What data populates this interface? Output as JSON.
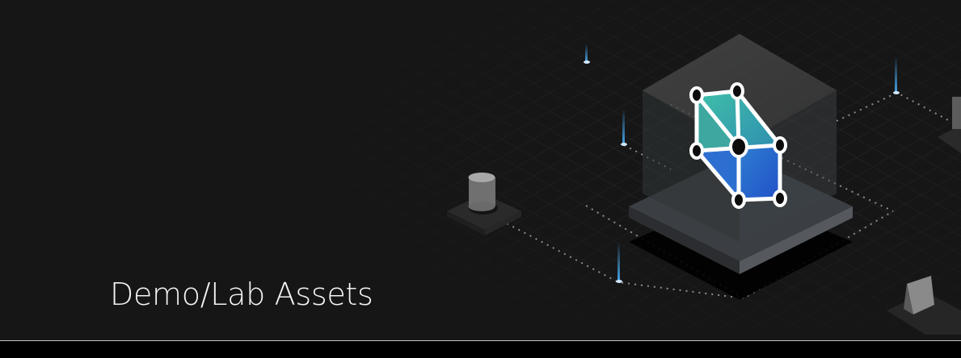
{
  "hero": {
    "title": "Demo/Lab Assets",
    "illustration": "isometric-platform-with-3d-network-icon",
    "colors": {
      "background": "#161616",
      "title": "#f4f4f4",
      "accent_teal": "#3ea7a0",
      "accent_blue": "#2a63d6",
      "beam": "#4ab3ff"
    }
  }
}
